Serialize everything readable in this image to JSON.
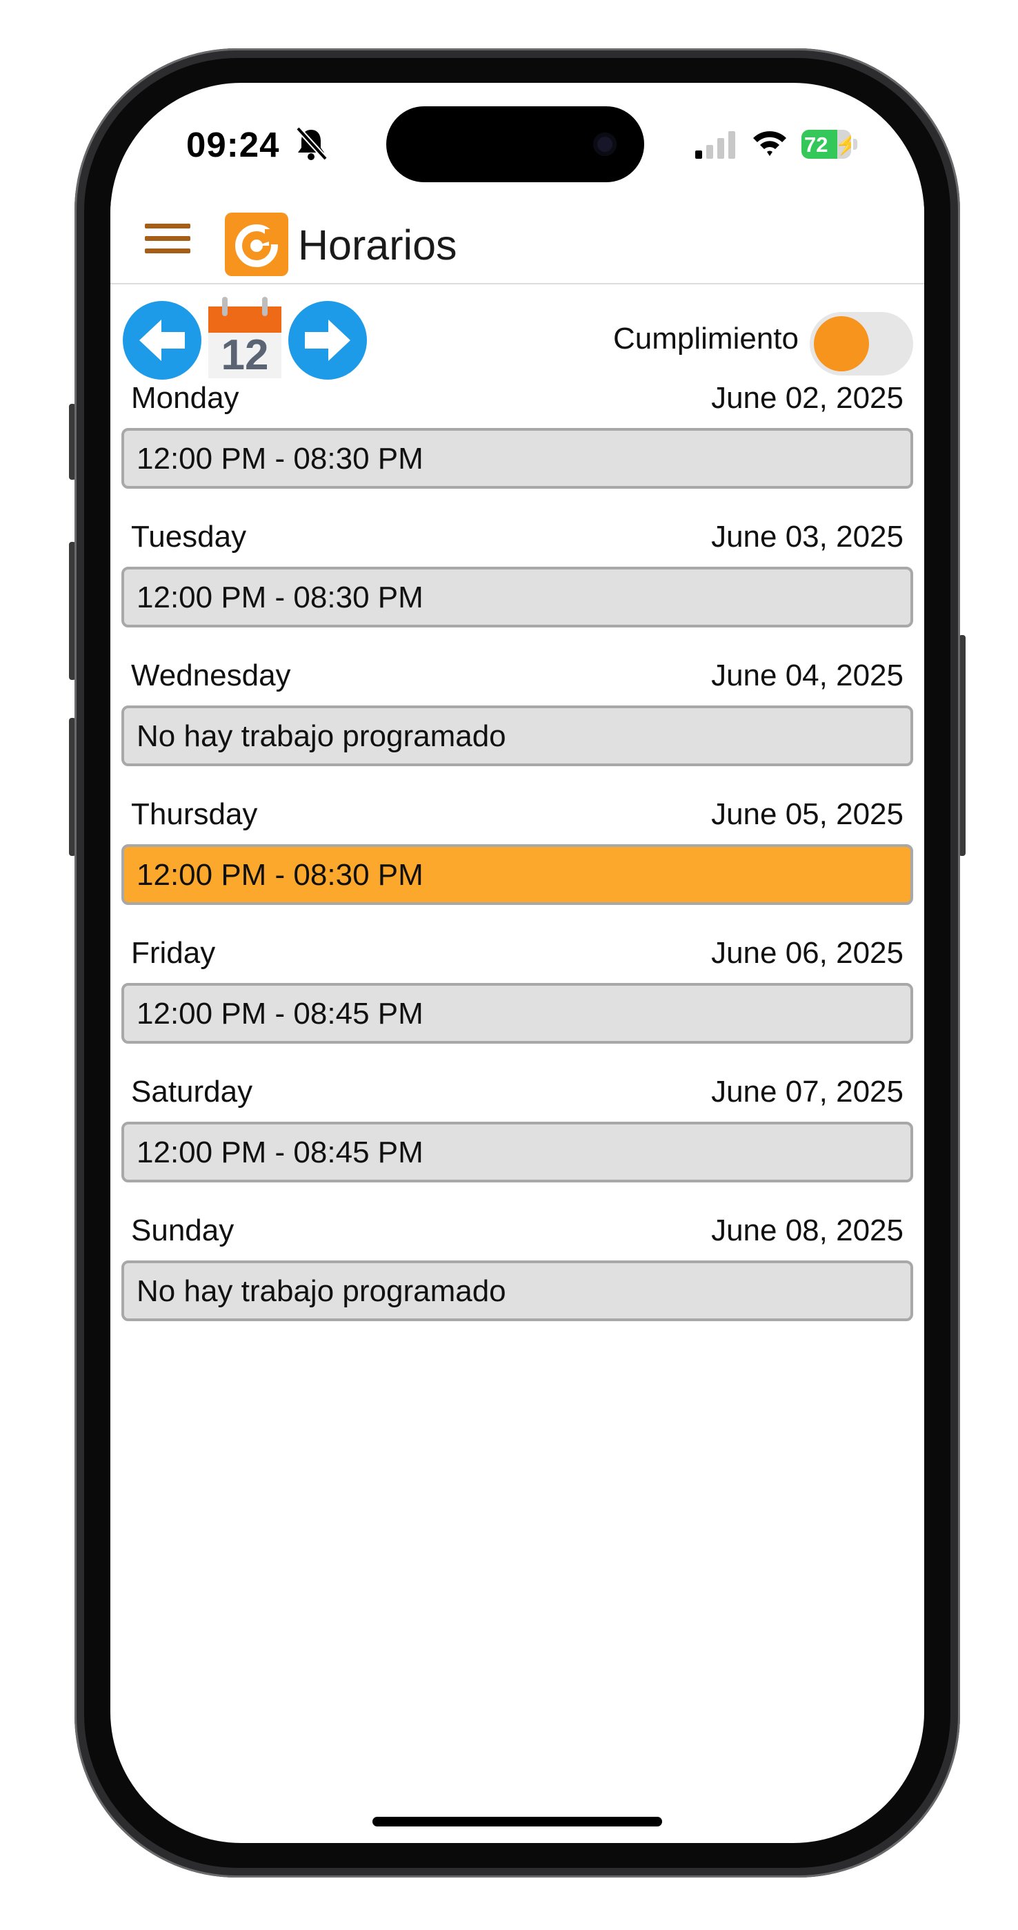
{
  "status_bar": {
    "time": "09:24",
    "battery": "72",
    "battery_fraction": 0.72
  },
  "header": {
    "title": "Horarios"
  },
  "toolbar": {
    "calendar_day": "12",
    "toggle_label": "Cumplimiento"
  },
  "schedule": [
    {
      "day": "Monday",
      "date": "June 02, 2025",
      "shift": "12:00 PM - 08:30 PM"
    },
    {
      "day": "Tuesday",
      "date": "June 03, 2025",
      "shift": "12:00 PM - 08:30 PM"
    },
    {
      "day": "Wednesday",
      "date": "June 04, 2025",
      "shift": "No hay trabajo programado"
    },
    {
      "day": "Thursday",
      "date": "June 05, 2025",
      "shift": "12:00 PM - 08:30 PM"
    },
    {
      "day": "Friday",
      "date": "June 06, 2025",
      "shift": "12:00 PM - 08:45 PM"
    },
    {
      "day": "Saturday",
      "date": "June 07, 2025",
      "shift": "12:00 PM - 08:45 PM"
    },
    {
      "day": "Sunday",
      "date": "June 08, 2025",
      "shift": "No hay trabajo programado"
    }
  ],
  "colors": {
    "accent": "#f7941d",
    "highlight": "#fca82c",
    "nav_blue": "#1e9be8",
    "menu_brown": "#a55e17"
  }
}
